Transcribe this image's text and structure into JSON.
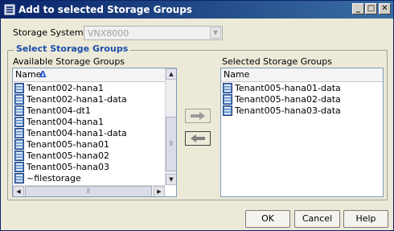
{
  "window": {
    "title": "Add to selected Storage Groups",
    "icon": "storage-groups-app-icon"
  },
  "titlebar_buttons": {
    "minimize": "_",
    "maximize": "□",
    "close": "✕"
  },
  "storage_system": {
    "label": "Storage System",
    "value": "VNX8000"
  },
  "group": {
    "title": "Select Storage Groups"
  },
  "available": {
    "label": "Available Storage Groups",
    "column": "Name",
    "sort_indicator": "Δ",
    "items": [
      "Tenant002-hana1",
      "Tenant002-hana1-data",
      "Tenant004-dt1",
      "Tenant004-hana1",
      "Tenant004-hana1-data",
      "Tenant005-hana01",
      "Tenant005-hana02",
      "Tenant005-hana03",
      "~filestorage"
    ]
  },
  "selected": {
    "label": "Selected Storage Groups",
    "column": "Name",
    "items": [
      "Tenant005-hana01-data",
      "Tenant005-hana02-data",
      "Tenant005-hana03-data"
    ]
  },
  "buttons": {
    "ok": "OK",
    "cancel": "Cancel",
    "help": "Help"
  }
}
